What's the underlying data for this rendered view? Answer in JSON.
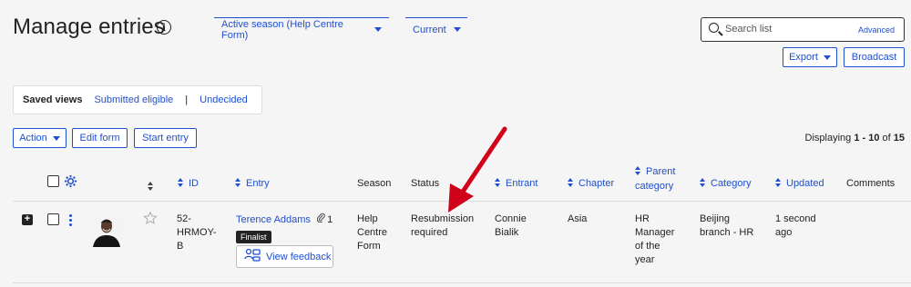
{
  "header": {
    "title": "Manage entries",
    "season_filter": "Active season (Help Centre Form)",
    "current_filter": "Current"
  },
  "search": {
    "placeholder": "Search list",
    "advanced": "Advanced"
  },
  "actions": {
    "export": "Export",
    "broadcast": "Broadcast"
  },
  "saved_views": {
    "label": "Saved views",
    "items": [
      "Submitted eligible",
      "|",
      "Undecided"
    ]
  },
  "toolbar": {
    "action": "Action",
    "edit_form": "Edit form",
    "start_entry": "Start entry"
  },
  "display": {
    "prefix": "Displaying ",
    "range": "1 - 10",
    "mid": " of ",
    "total": "15"
  },
  "columns": {
    "id": "ID",
    "entry": "Entry",
    "season": "Season",
    "status": "Status",
    "entrant": "Entrant",
    "chapter": "Chapter",
    "parent_category_1": "Parent",
    "parent_category_2": "category",
    "category": "Category",
    "updated": "Updated",
    "comments": "Comments"
  },
  "rows": [
    {
      "id_lines": [
        "52-",
        "HRMOY-",
        "B"
      ],
      "entry": "Terence Addams",
      "attachments": "1",
      "badge": "Finalist",
      "feedback": "View feedback",
      "season_lines": [
        "Help",
        "Centre",
        "Form"
      ],
      "status_lines": [
        "Resubmission",
        "required"
      ],
      "entrant_lines": [
        "Connie",
        "Bialik"
      ],
      "chapter": "Asia",
      "parent_category_lines": [
        "HR",
        "Manager",
        "of the",
        "year"
      ],
      "category_lines": [
        "Beijing",
        "branch - HR"
      ],
      "updated_lines": [
        "1 second",
        "ago"
      ]
    }
  ],
  "colors": {
    "accent": "#1f4fd1",
    "annotation_arrow": "#d0021b"
  },
  "icons": [
    "info-icon",
    "chevron-down-icon",
    "search-icon",
    "gear-icon",
    "sort-icon",
    "expand-plus-icon",
    "kebab-menu-icon",
    "star-icon",
    "paperclip-icon",
    "feedback-icon",
    "red-annotation-arrow"
  ]
}
